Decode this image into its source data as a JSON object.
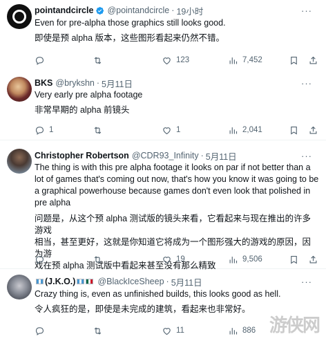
{
  "tweets": [
    {
      "name": "pointandcircle",
      "verified": true,
      "handle": "@pointandcircle",
      "sep": "·",
      "time": "19小时",
      "lines": [
        "Even for pre-alpha those graphics still looks good.",
        "即使是预 alpha 版本，这些图形看起来仍然不错。"
      ],
      "replies": "",
      "retweets": "",
      "likes": "123",
      "views": "7,452"
    },
    {
      "name": "BKS",
      "handle": "@brykshn",
      "sep": "·",
      "time": "5月11日",
      "lines": [
        "Very early pre alpha footage",
        "非常早期的 alpha 前镜头"
      ],
      "replies": "1",
      "retweets": "",
      "likes": "1",
      "views": "2,041"
    },
    {
      "name": "Christopher Robertson",
      "handle": "@CDR93_Infinity",
      "sep": "·",
      "time": "5月11日",
      "lines": [
        "The thing is with this pre alpha footage it looks on par if not better than a",
        "lot of games that's coming out now, that's how you know it was going to be",
        "a graphical powerhouse because games don't even look that polished in",
        "pre alpha",
        "问题是，从这个预 alpha 测试版的镜头来看，它看起来与现在推出的许多游戏",
        "相当，甚至更好，这就是你知道它将成为一个图形强大的游戏的原因，因为游",
        "戏在预 alpha 测试版中看起来甚至没有那么精致"
      ],
      "replies": "",
      "retweets": "",
      "likes": "19",
      "views": "9,506"
    },
    {
      "name": "(J.K.O.)",
      "handle": "@BlackIceSheep",
      "sep": "·",
      "time": "5月11日",
      "lines": [
        "Crazy thing is, even as unfinished builds, this looks good as hell.",
        "令人疯狂的是，即使是未完成的建筑，看起来也非常好。"
      ],
      "replies": "",
      "retweets": "",
      "likes": "11",
      "views": "886"
    }
  ],
  "more_label": "···",
  "watermark": "游侠网",
  "icons": [
    "reply-icon",
    "retweet-icon",
    "like-icon",
    "views-icon",
    "bookmark-icon",
    "share-icon",
    "verified-badge-icon",
    "more-icon"
  ]
}
